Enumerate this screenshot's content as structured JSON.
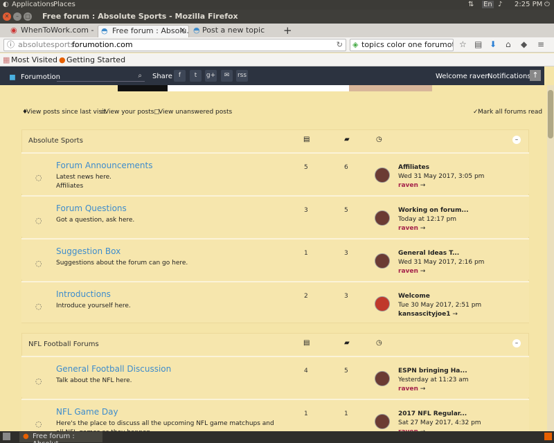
{
  "desktop": {
    "applications": "Applications",
    "places": "Places",
    "lang": "En",
    "time": "2:25 PM"
  },
  "window": {
    "title": "Free forum : Absolute Sports - Mozilla Firefox"
  },
  "tabs": [
    {
      "label": "WhenToWork.com -..."
    },
    {
      "label": "Free forum : Absolu..."
    },
    {
      "label": "Post a new topic"
    }
  ],
  "nav": {
    "url_prefix": "absolutesports.",
    "url_domain": "forumotion.com",
    "search": "topics color one forumotion"
  },
  "bookmarks": [
    "Most Visited",
    "Getting Started"
  ],
  "forumbar": {
    "brand": "Forumotion",
    "share": "Share :",
    "welcome": "Welcome raven",
    "notifications": "Notifications",
    "share_icons": [
      "f",
      "t",
      "g+",
      "✉",
      "rss"
    ]
  },
  "links": {
    "since": "View posts since last visit",
    "yours": "View your posts",
    "unanswered": "View unanswered posts",
    "markall": "Mark all forums read"
  },
  "categories": [
    {
      "name": "Absolute Sports",
      "forums": [
        {
          "title": "Forum Announcements",
          "desc": "Latest news here.",
          "sub": "Affiliates",
          "topics": "5",
          "posts": "6",
          "last_title": "Affiliates",
          "last_date": "Wed 31 May 2017, 3:05 pm",
          "last_user": "raven"
        },
        {
          "title": "Forum Questions",
          "desc": "Got a question, ask here.",
          "sub": "",
          "topics": "3",
          "posts": "5",
          "last_title": "Working on forum...",
          "last_date": "Today at 12:17 pm",
          "last_user": "raven"
        },
        {
          "title": "Suggestion Box",
          "desc": "Suggestions about the forum can go here.",
          "sub": "",
          "topics": "1",
          "posts": "3",
          "last_title": "General Ideas T...",
          "last_date": "Wed 31 May 2017, 2:16 pm",
          "last_user": "raven"
        },
        {
          "title": "Introductions",
          "desc": "Introduce yourself here.",
          "sub": "",
          "topics": "2",
          "posts": "3",
          "last_title": "Welcome",
          "last_date": "Tue 30 May 2017, 2:51 pm",
          "last_user": "kansascityjoe1"
        }
      ]
    },
    {
      "name": "NFL Football Forums",
      "forums": [
        {
          "title": "General Football Discussion",
          "desc": "Talk about the NFL here.",
          "sub": "",
          "topics": "4",
          "posts": "5",
          "last_title": "ESPN bringing Ha...",
          "last_date": "Yesterday at 11:23 am",
          "last_user": "raven"
        },
        {
          "title": "NFL Game Day",
          "desc": "Here's the place to discuss all the upcoming NFL game matchups and all NFL games as they happen.",
          "sub": "",
          "topics": "1",
          "posts": "1",
          "last_title": "2017 NFL Regular...",
          "last_date": "Sat 27 May 2017, 4:32 pm",
          "last_user": "raven"
        }
      ]
    }
  ],
  "taskbar": {
    "label": "Free forum : Absolut..."
  }
}
